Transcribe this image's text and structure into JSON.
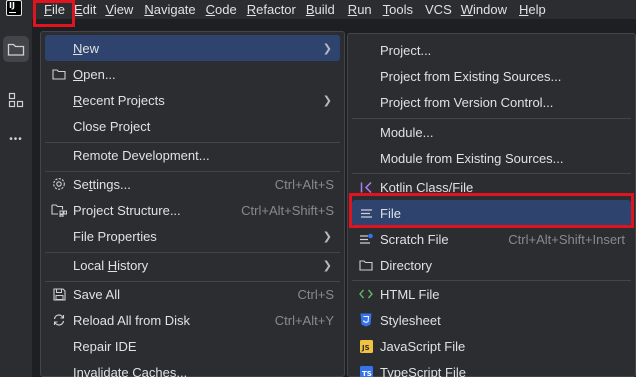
{
  "menubar": {
    "logo": "IJ",
    "items": [
      {
        "u": "F",
        "rest": "ile"
      },
      {
        "u": "E",
        "rest": "dit"
      },
      {
        "u": "V",
        "rest": "iew"
      },
      {
        "u": "N",
        "rest": "avigate"
      },
      {
        "u": "C",
        "rest": "ode"
      },
      {
        "u": "R",
        "rest": "efactor"
      },
      {
        "u": "B",
        "rest": "uild"
      },
      {
        "u": "R",
        "rest": "un"
      },
      {
        "u": "T",
        "rest": "ools"
      },
      {
        "u": "",
        "rest": "VCS"
      },
      {
        "u": "W",
        "rest": "indow"
      },
      {
        "u": "H",
        "rest": "elp"
      }
    ]
  },
  "toolbar": {
    "icons": [
      "folder-icon",
      "structure-icon",
      "more-icon"
    ],
    "more_label": "•••"
  },
  "file_menu": {
    "items": {
      "new": {
        "u": "N",
        "rest": "ew"
      },
      "open": {
        "u": "O",
        "rest": "pen..."
      },
      "recent": {
        "u": "R",
        "rest": "ecent Projects"
      },
      "close": "Close Project",
      "remote": "Remote Development...",
      "settings": {
        "pre": "Se",
        "u": "t",
        "rest": "tings...",
        "shortcut": "Ctrl+Alt+S"
      },
      "structure": {
        "label": "Project Structure...",
        "shortcut": "Ctrl+Alt+Shift+S"
      },
      "properties": "File Properties",
      "history": {
        "pre": "Local ",
        "u": "H",
        "rest": "istory"
      },
      "save": {
        "label": "Save All",
        "shortcut": "Ctrl+S"
      },
      "reload": {
        "label": "Reload All from Disk",
        "shortcut": "Ctrl+Alt+Y"
      },
      "repair": "Repair IDE",
      "invalidate": "Invalidate Caches..."
    }
  },
  "new_menu": {
    "items": {
      "project": "Project...",
      "existing": "Project from Existing Sources...",
      "vcs": "Project from Version Control...",
      "module": "Module...",
      "module_existing": "Module from Existing Sources...",
      "kotlin": "Kotlin Class/File",
      "file": "File",
      "scratch": {
        "label": "Scratch File",
        "shortcut": "Ctrl+Alt+Shift+Insert"
      },
      "directory": "Directory",
      "html": "HTML File",
      "stylesheet": "Stylesheet",
      "js": "JavaScript File",
      "ts": "TypeScript File"
    }
  },
  "colors": {
    "highlight": "#e0141e",
    "selection": "#2e436e",
    "background": "#2b2d30"
  }
}
